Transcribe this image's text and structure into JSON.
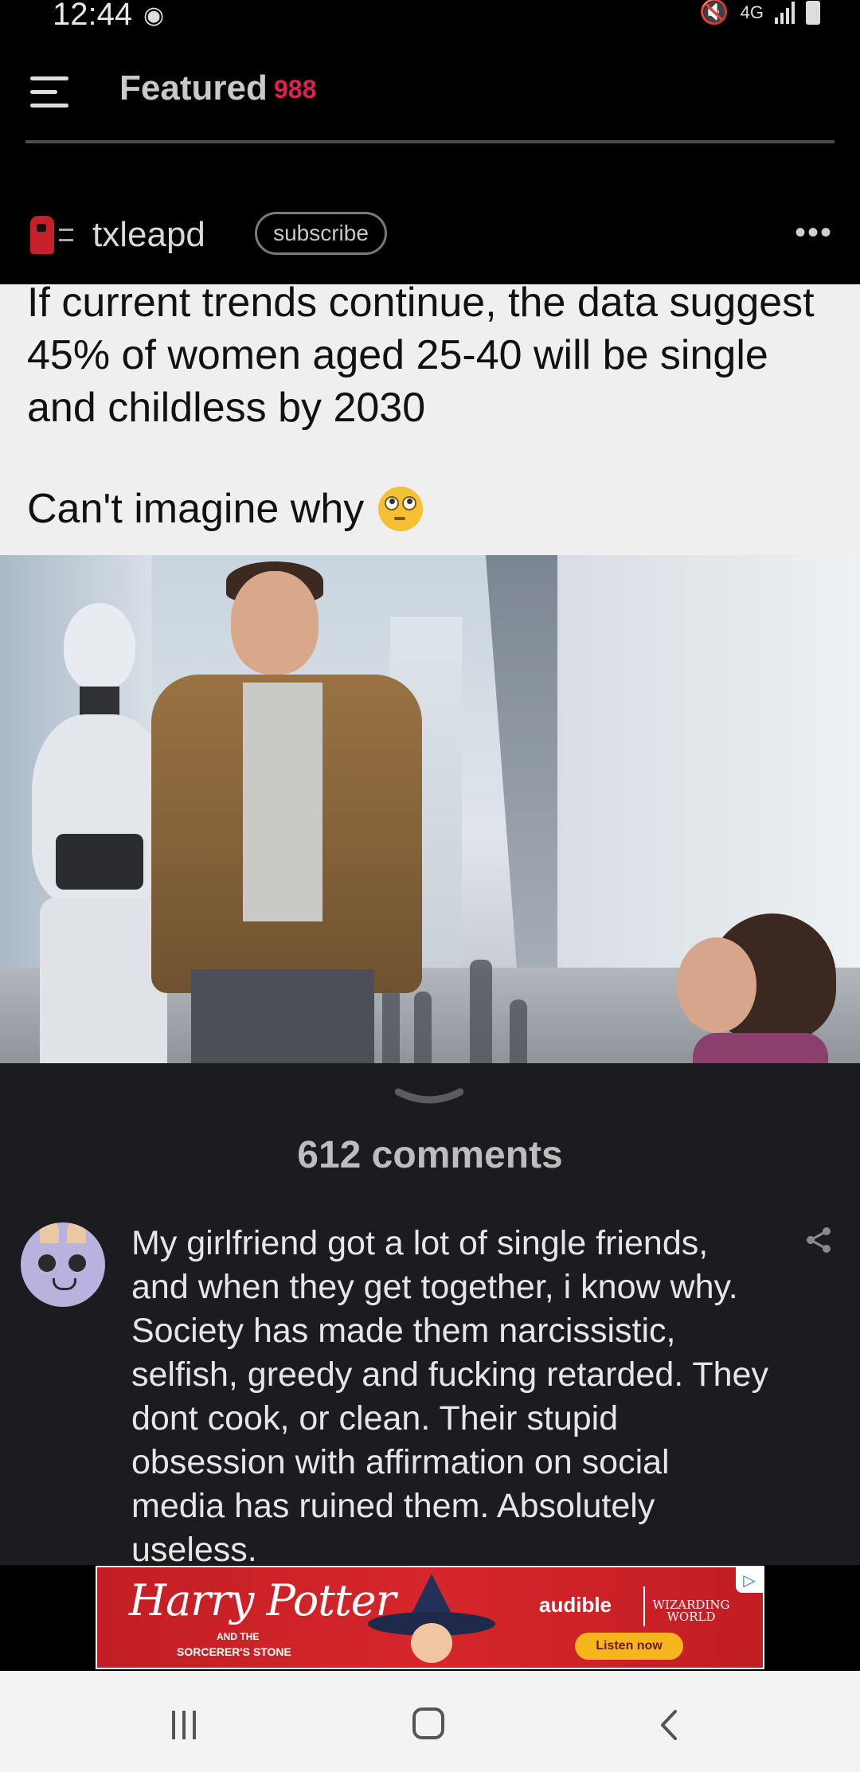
{
  "status_bar": {
    "time": "12:44",
    "network": "4G"
  },
  "header": {
    "title": "Featured",
    "count": "988"
  },
  "post": {
    "author": "txleapd",
    "subscribe_label": "subscribe",
    "more_label": "•••",
    "caption": "If current trends continue, the data suggest 45% of women aged 25-40 will be single and childless by 2030",
    "aside": "Can't imagine why"
  },
  "comments": {
    "title": "612 comments",
    "items": [
      {
        "text": "My girlfriend got a lot of single friends, and when they get together, i know why. Society has made them narcissistic, selfish, greedy and fucking retarded. They dont cook, or clean. Their stupid obsession with affirmation on social media has ruined them. Absolutely useless."
      }
    ]
  },
  "ad": {
    "title": "Harry Potter",
    "subtitle_and_the": "AND THE",
    "subtitle": "SORCERER'S STONE",
    "brand": "audible",
    "partner": "WIZARDING WORLD",
    "cta": "Listen now"
  },
  "colors": {
    "accent": "#e0214f",
    "background": "#000000",
    "comments_bg": "#1b1c20",
    "ad_red": "#c31e25"
  }
}
